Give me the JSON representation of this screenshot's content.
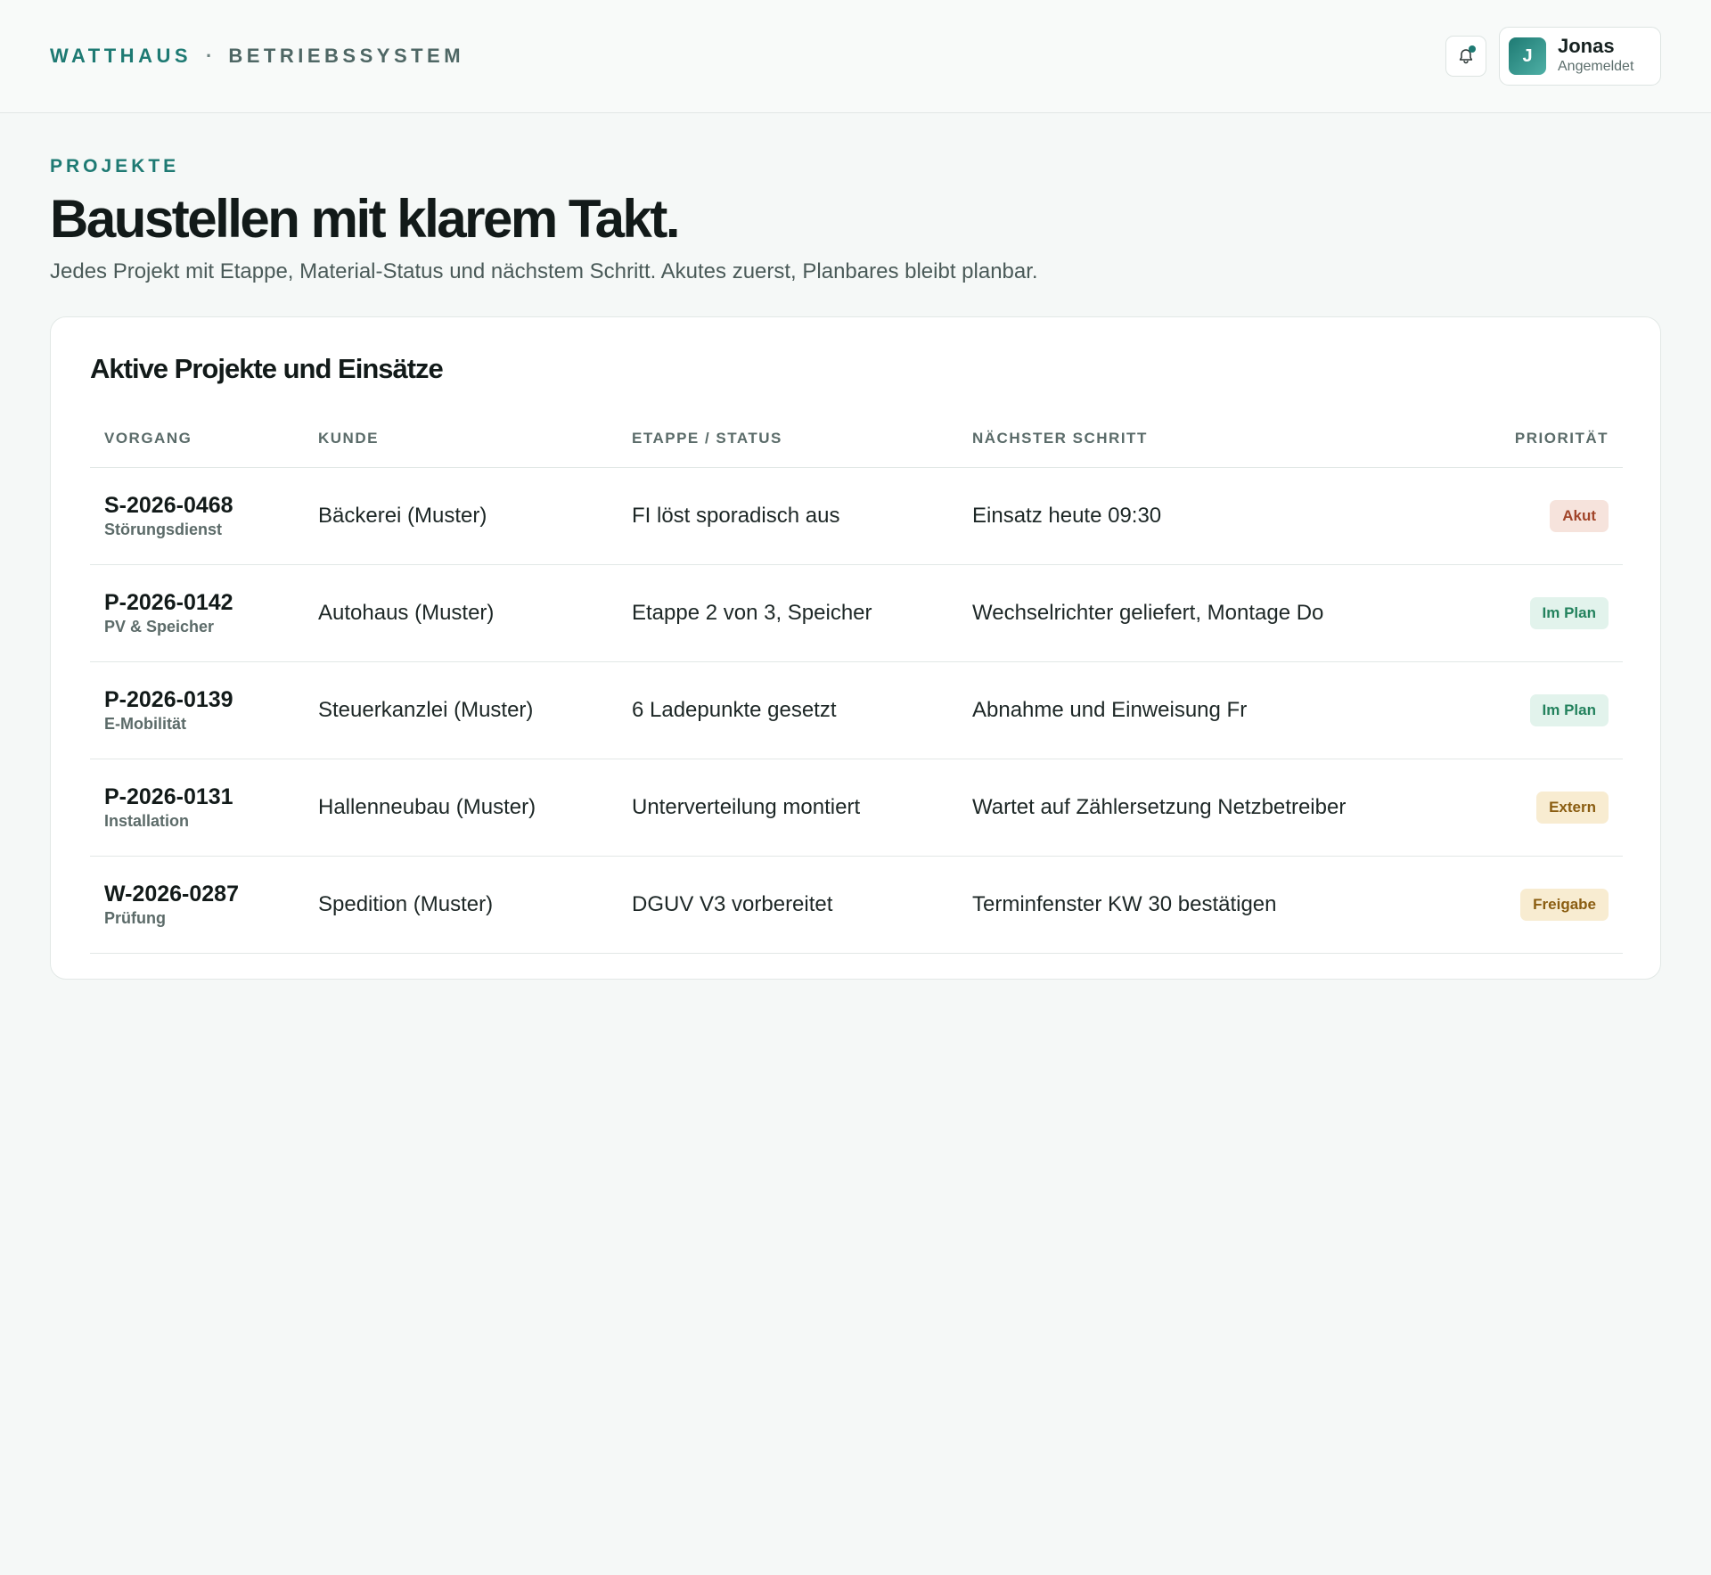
{
  "brand": {
    "name": "WATTHAUS",
    "separator": "·",
    "sub": "BETRIEBSSYSTEM"
  },
  "user": {
    "initial": "J",
    "name": "Jonas",
    "status": "Angemeldet"
  },
  "page": {
    "eyebrow": "PROJEKTE",
    "title": "Baustellen mit klarem Takt.",
    "subtitle": "Jedes Projekt mit Etappe, Material-Status und nächstem Schritt. Akutes zuerst, Planbares bleibt planbar."
  },
  "card": {
    "title": "Aktive Projekte und Einsätze",
    "columns": [
      "VORGANG",
      "KUNDE",
      "ETAPPE / STATUS",
      "NÄCHSTER SCHRITT",
      "PRIORITÄT"
    ],
    "rows": [
      {
        "id": "S-2026-0468",
        "type": "Störungsdienst",
        "customer": "Bäckerei (Muster)",
        "stage": "FI löst sporadisch aus",
        "next": "Einsatz heute 09:30",
        "priority": "Akut",
        "priority_bg": "#f6e3dc",
        "priority_fg": "#a1452a"
      },
      {
        "id": "P-2026-0142",
        "type": "PV & Speicher",
        "customer": "Autohaus (Muster)",
        "stage": "Etappe 2 von 3, Speicher",
        "next": "Wechselrichter geliefert, Montage Do",
        "priority": "Im Plan",
        "priority_bg": "#e2f3ec",
        "priority_fg": "#23825d"
      },
      {
        "id": "P-2026-0139",
        "type": "E-Mobilität",
        "customer": "Steuerkanzlei (Muster)",
        "stage": "6 Ladepunkte gesetzt",
        "next": "Abnahme und Einweisung Fr",
        "priority": "Im Plan",
        "priority_bg": "#e2f3ec",
        "priority_fg": "#23825d"
      },
      {
        "id": "P-2026-0131",
        "type": "Installation",
        "customer": "Hallenneubau (Muster)",
        "stage": "Unterverteilung montiert",
        "next": "Wartet auf Zählersetzung Netzbetreiber",
        "priority": "Extern",
        "priority_bg": "#f8ecd1",
        "priority_fg": "#8a5d11"
      },
      {
        "id": "W-2026-0287",
        "type": "Prüfung",
        "customer": "Spedition (Muster)",
        "stage": "DGUV V3 vorbereitet",
        "next": "Terminfenster KW 30 bestätigen",
        "priority": "Freigabe",
        "priority_bg": "#f8ecd1",
        "priority_fg": "#8a5d11"
      }
    ]
  },
  "icons": {
    "notification": "bell-icon"
  },
  "colors": {
    "accent": "#1e7a73",
    "background": "#f5f8f7"
  }
}
